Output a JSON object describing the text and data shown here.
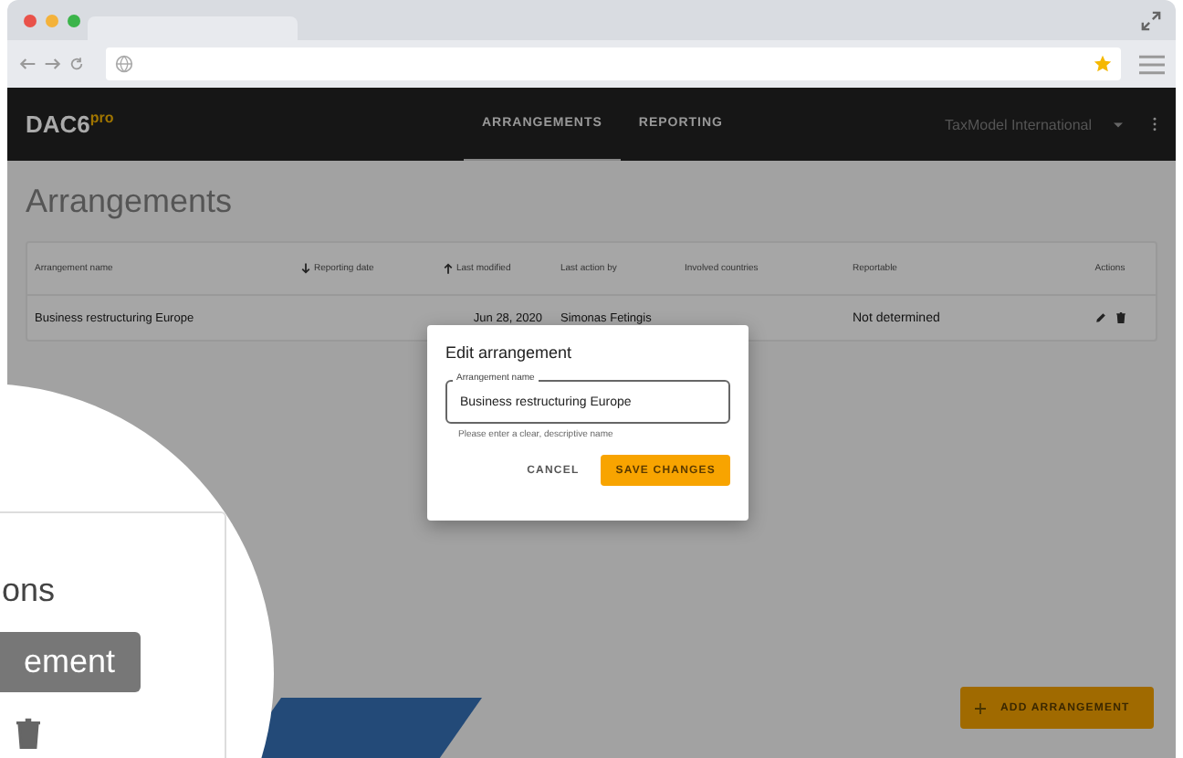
{
  "header": {
    "logo": "DAC6$^{pro}$",
    "nav": [
      {
        "label": "ARRANGEMENTS",
        "selected": true
      },
      {
        "label": "REPORTING",
        "selected": false
      }
    ],
    "organization": "TaxModel International"
  },
  "page_title": "Arrangements",
  "table": {
    "columns": [
      {
        "label": "Arrangement name",
        "sorted_ascending": false,
        "sorted_descending": false
      },
      {
        "label": "Reporting date",
        "sorted_ascending": false,
        "sorted_descending": true
      },
      {
        "label": "Last modified",
        "sorted_ascending": true,
        "sorted_descending": false
      },
      {
        "label": "Last action by",
        "sorted_ascending": false,
        "sorted_descending": false
      },
      {
        "label": "Involved countries",
        "sorted_ascending": false,
        "sorted_descending": false
      },
      {
        "label": "Reportable",
        "sorted_ascending": false,
        "sorted_descending": false
      },
      {
        "label": "Actions",
        "sorted_ascending": false,
        "sorted_descending": false
      }
    ],
    "rows": [
      {
        "name": "Business restructuring Europe",
        "last_modified": "Jun 28, 2020",
        "last_action_by": "Simonas Fetingis",
        "reportable": "Not determined"
      }
    ]
  },
  "dialog": {
    "title": "Edit arrangement",
    "field_label": "Arrangement name",
    "field_value": "Business restructuring Europe",
    "helper": "Please enter a clear, descriptive name",
    "buttons": [
      {
        "label": "CANCEL",
        "kind": "text"
      },
      {
        "label": "SAVE CHANGES",
        "kind": "primary"
      }
    ]
  },
  "fab": {
    "label": "ADD ARRANGEMENT"
  },
  "magnifier": {
    "heading": "ons",
    "button": "ement"
  }
}
